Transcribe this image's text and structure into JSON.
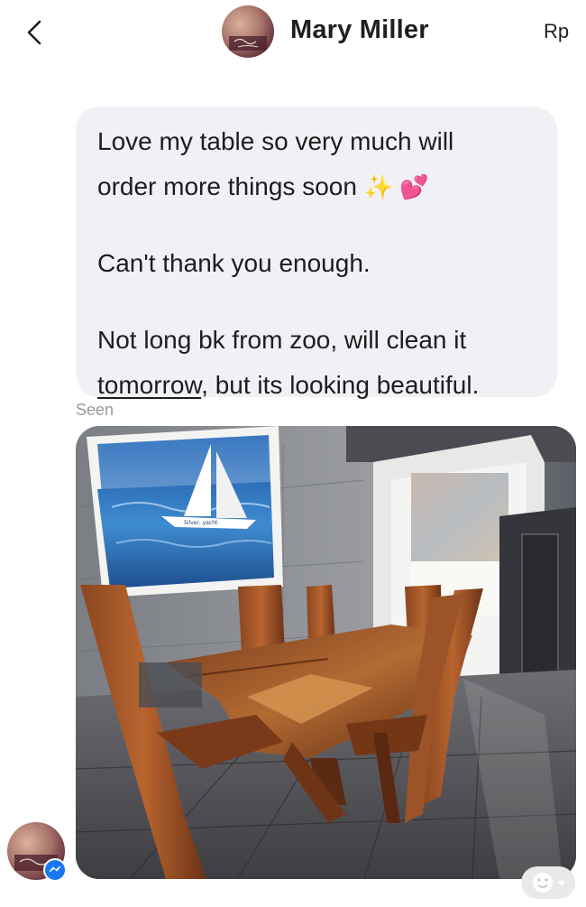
{
  "header": {
    "contact_name": "Mary Miller",
    "right_label": "Rp"
  },
  "message": {
    "line1": "Love my table so very much will",
    "line2": "order more things soon",
    "line2_emoji": "✨ 💕",
    "line3": "Can't thank you enough.",
    "line4": "Not long bk from zoo, will clean it",
    "line5_underlined": "tomorrow",
    "line5_rest": ", but its looking beautiful."
  },
  "status": {
    "seen": "Seen"
  },
  "photo_painting_text": "Silver, yacht",
  "icons": {
    "back": "chevron-left-icon",
    "messenger": "messenger-icon",
    "reaction": "add-reaction-icon"
  },
  "colors": {
    "bubble": "#f1f1f5",
    "name_text": "#1f1f1f",
    "seen_text": "#9a9a9a",
    "messenger_blue": "#1877f2"
  }
}
